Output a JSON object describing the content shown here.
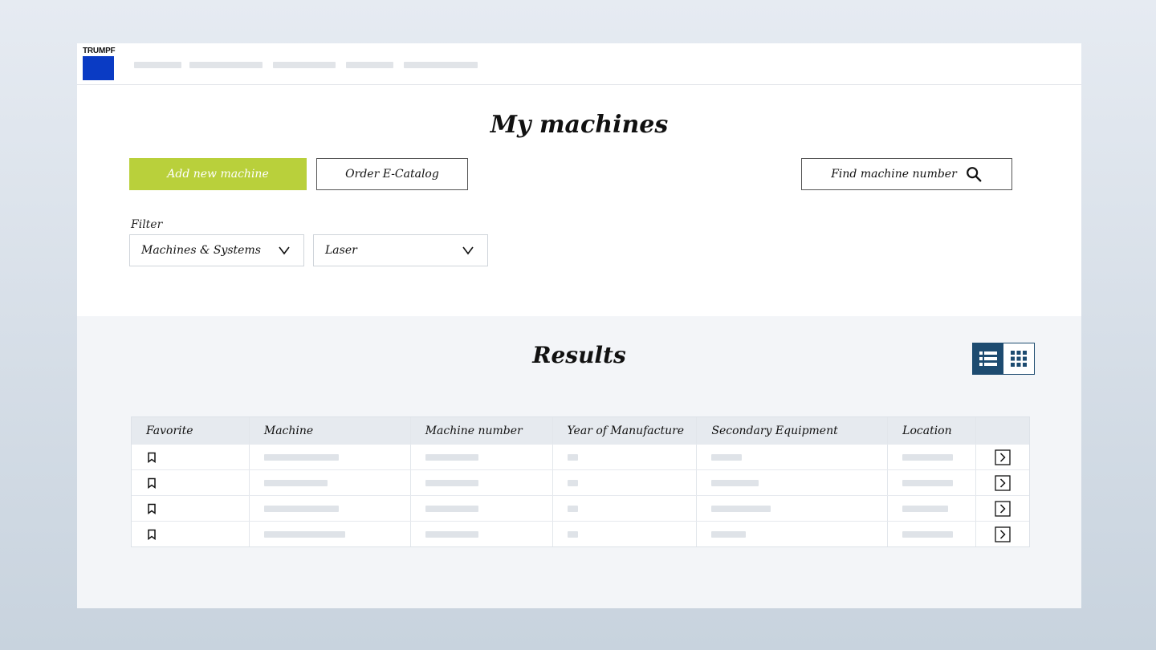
{
  "brand": {
    "logo_text": "TRUMPF",
    "logo_color": "#0a3bc4"
  },
  "page": {
    "title": "My machines"
  },
  "actions": {
    "add_label": "Add new machine",
    "catalog_label": "Order E-Catalog",
    "find_label": "Find machine number",
    "accent_color": "#b9d03b"
  },
  "filter": {
    "label": "Filter",
    "category_value": "Machines & Systems",
    "type_value": "Laser"
  },
  "results": {
    "title": "Results",
    "view_modes": [
      "list",
      "grid"
    ],
    "active_view": "list",
    "columns": [
      "Favorite",
      "Machine",
      "Machine number",
      "Year of Manufacture",
      "Secondary Equipment",
      "Location",
      ""
    ],
    "rows": [
      {
        "favorite": false
      },
      {
        "favorite": false
      },
      {
        "favorite": false
      },
      {
        "favorite": false
      }
    ]
  },
  "icons": {
    "search": "search-icon",
    "dropdown": "chevron-down-icon",
    "bookmark": "bookmark-icon",
    "row_open": "chevron-right-box-icon",
    "list_view": "list-view-icon",
    "grid_view": "grid-view-icon"
  }
}
